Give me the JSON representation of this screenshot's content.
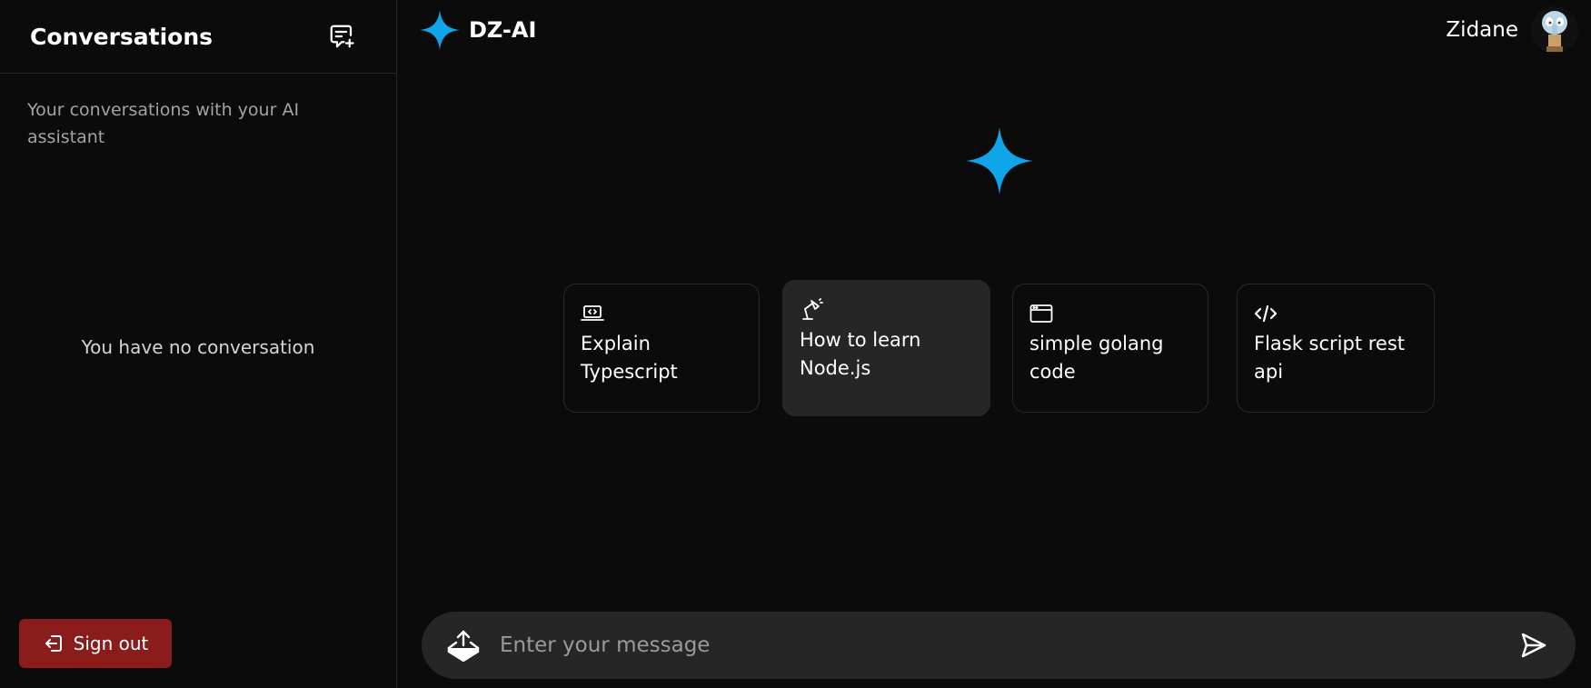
{
  "sidebar": {
    "title": "Conversations",
    "description": "Your conversations with your AI assistant",
    "empty_text": "You have no conversation",
    "signout_label": "Sign out"
  },
  "header": {
    "brand": "DZ-AI",
    "user_name": "Zidane"
  },
  "suggestions": [
    {
      "icon": "laptop-code-icon",
      "label": "Explain Typescript"
    },
    {
      "icon": "desk-lamp-icon",
      "label": "How to learn Node.js"
    },
    {
      "icon": "browser-window-icon",
      "label": "simple golang code"
    },
    {
      "icon": "code-icon",
      "label": "Flask script rest api"
    }
  ],
  "composer": {
    "placeholder": "Enter your message"
  },
  "colors": {
    "accent": "#0ea5e9",
    "background": "#0b0b0b",
    "panel": "#262626",
    "danger": "#8b1c1c"
  }
}
